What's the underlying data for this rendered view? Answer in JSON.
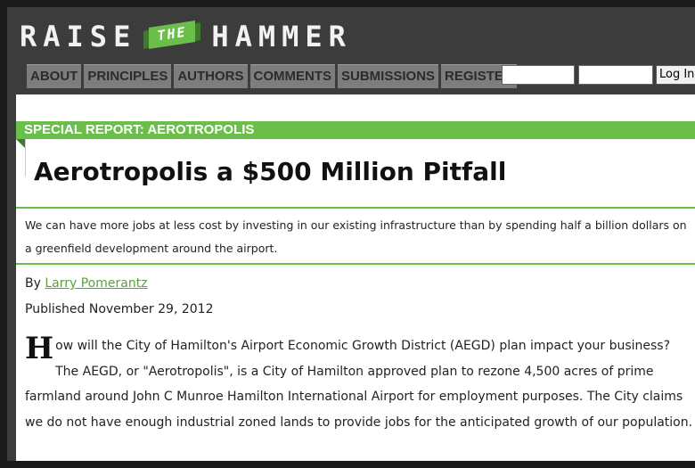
{
  "logo": {
    "word1": "RAISE",
    "the": "THE",
    "word2": "HAMMER"
  },
  "nav": {
    "items": [
      "ABOUT",
      "PRINCIPLES",
      "AUTHORS",
      "COMMENTS",
      "SUBMISSIONS",
      "REGISTER"
    ]
  },
  "login": {
    "username_value": "",
    "password_value": "",
    "button_label": "Log In"
  },
  "article": {
    "section_label": "SPECIAL REPORT: AEROTROPOLIS",
    "title": "Aerotropolis a $500 Million Pitfall",
    "summary": "We can have more jobs at less cost by investing in our existing infrastructure than by spending half a billion dollars on a greenfield development around the airport.",
    "byline_prefix": "By",
    "author": "Larry Pomerantz",
    "published": "Published November 29, 2012",
    "dropcap": "H",
    "body": "ow will the City of Hamilton's Airport Economic Growth District (AEGD) plan impact your business? The AEGD, or \"Aerotropolis\", is a City of Hamilton approved plan to rezone 4,500 acres of prime farmland around John C Munroe Hamilton International Airport for employment purposes. The City claims we do not have enough industrial zoned lands to provide jobs for the anticipated growth of our population."
  },
  "colors": {
    "accent": "#6abf4b",
    "header_bg": "#3c3c3c",
    "nav_bg": "#7d7d7d"
  }
}
